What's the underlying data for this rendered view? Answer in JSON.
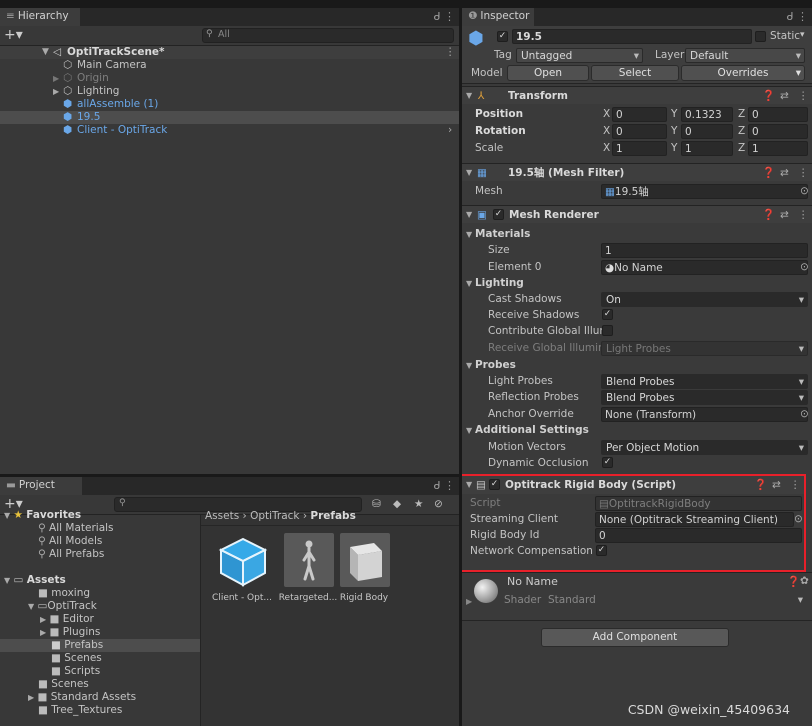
{
  "hierarchy": {
    "tab_label": "Hierarchy",
    "search_placeholder": "All",
    "scene": "OptiTrackScene*",
    "items": [
      "Main Camera",
      "Origin",
      "Lighting",
      "allAssemble (1)",
      "19.5",
      "Client - OptiTrack"
    ]
  },
  "inspector": {
    "tab_label": "Inspector",
    "object_name": "19.5",
    "static_label": "Static",
    "tag_label": "Tag",
    "tag_value": "Untagged",
    "layer_label": "Layer",
    "layer_value": "Default",
    "model_label": "Model",
    "model_buttons": [
      "Open",
      "Select",
      "Overrides"
    ],
    "transform": {
      "title": "Transform",
      "position_label": "Position",
      "position": {
        "x": "0",
        "y": "0.1323",
        "z": "0"
      },
      "rotation_label": "Rotation",
      "rotation": {
        "x": "0",
        "y": "0",
        "z": "0"
      },
      "scale_label": "Scale",
      "scale": {
        "x": "1",
        "y": "1",
        "z": "1"
      }
    },
    "mesh_filter": {
      "title": "19.5轴 (Mesh Filter)",
      "mesh_label": "Mesh",
      "mesh_value": "19.5轴"
    },
    "mesh_renderer": {
      "title": "Mesh Renderer",
      "materials_label": "Materials",
      "size_label": "Size",
      "size_value": "1",
      "element_label": "Element 0",
      "element_value": "No Name",
      "lighting_label": "Lighting",
      "cast_shadows_label": "Cast Shadows",
      "cast_shadows_value": "On",
      "receive_shadows_label": "Receive Shadows",
      "contribute_gi_label": "Contribute Global Illumi",
      "receive_gi_label": "Receive Global Illumina",
      "receive_gi_value": "Light Probes",
      "probes_label": "Probes",
      "light_probes_label": "Light Probes",
      "light_probes_value": "Blend Probes",
      "reflection_probes_label": "Reflection Probes",
      "reflection_probes_value": "Blend Probes",
      "anchor_override_label": "Anchor Override",
      "anchor_override_value": "None (Transform)",
      "additional_label": "Additional Settings",
      "motion_vectors_label": "Motion Vectors",
      "motion_vectors_value": "Per Object Motion",
      "dynamic_occlusion_label": "Dynamic Occlusion"
    },
    "rigid_body": {
      "title": "Optitrack Rigid Body (Script)",
      "script_label": "Script",
      "script_value": "OptitrackRigidBody",
      "streaming_client_label": "Streaming Client",
      "streaming_client_value": "None (Optitrack Streaming Client)",
      "rigid_body_id_label": "Rigid Body Id",
      "rigid_body_id_value": "0",
      "network_comp_label": "Network Compensation"
    },
    "material": {
      "name": "No Name",
      "shader_label": "Shader",
      "shader_value": "Standard"
    },
    "add_component": "Add Component"
  },
  "project": {
    "tab_label": "Project",
    "favorites_label": "Favorites",
    "favorites": [
      "All Materials",
      "All Models",
      "All Prefabs"
    ],
    "assets_label": "Assets",
    "tree": [
      "moxing",
      "OptiTrack",
      "Editor",
      "Plugins",
      "Prefabs",
      "Scenes",
      "Scripts",
      "Scenes",
      "Standard Assets",
      "Tree_Textures"
    ],
    "breadcrumb": [
      "Assets",
      "OptiTrack",
      "Prefabs"
    ],
    "assets": [
      "Client - Opt...",
      "Retargeted...",
      "Rigid Body"
    ]
  },
  "watermark": "CSDN @weixin_45409634",
  "colors": {
    "highlight": "#e8202a",
    "selection": "#2c5d87",
    "accent_blue": "#6aa7e8"
  }
}
